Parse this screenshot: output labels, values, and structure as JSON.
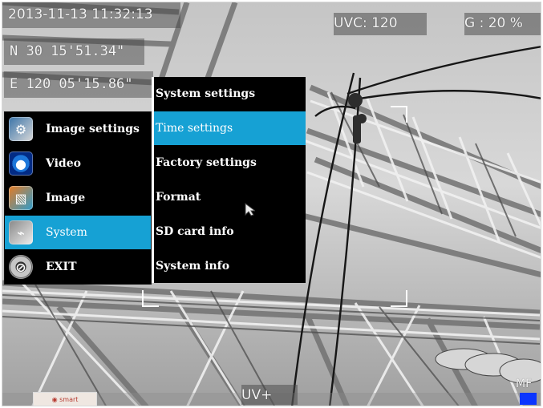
{
  "osd": {
    "datetime": "2013-11-13 11:32:13",
    "latitude": "N 30 15'51.34\"",
    "longitude": "E 120 05'15.86\"",
    "uvc": "UVC: 120",
    "gain": "G : 20 %",
    "uv_plus": "UV+",
    "focus_mode": "MF"
  },
  "main_menu": [
    {
      "label": "Image settings",
      "icon": "image-settings-icon"
    },
    {
      "label": "Video",
      "icon": "video-icon"
    },
    {
      "label": "Image",
      "icon": "image-icon"
    },
    {
      "label": "System",
      "icon": "system-icon",
      "selected": true
    },
    {
      "label": "EXIT",
      "icon": "exit-icon"
    }
  ],
  "sub_menu": [
    {
      "label": "System settings"
    },
    {
      "label": "Time settings",
      "selected": true
    },
    {
      "label": "Factory settings"
    },
    {
      "label": "Format"
    },
    {
      "label": "SD card info"
    },
    {
      "label": "System info"
    }
  ],
  "colors": {
    "menu_background": "#000000",
    "selection": "#16a1d4",
    "osd_text": "#f4f4f4",
    "indicator": "#0b35ff"
  }
}
